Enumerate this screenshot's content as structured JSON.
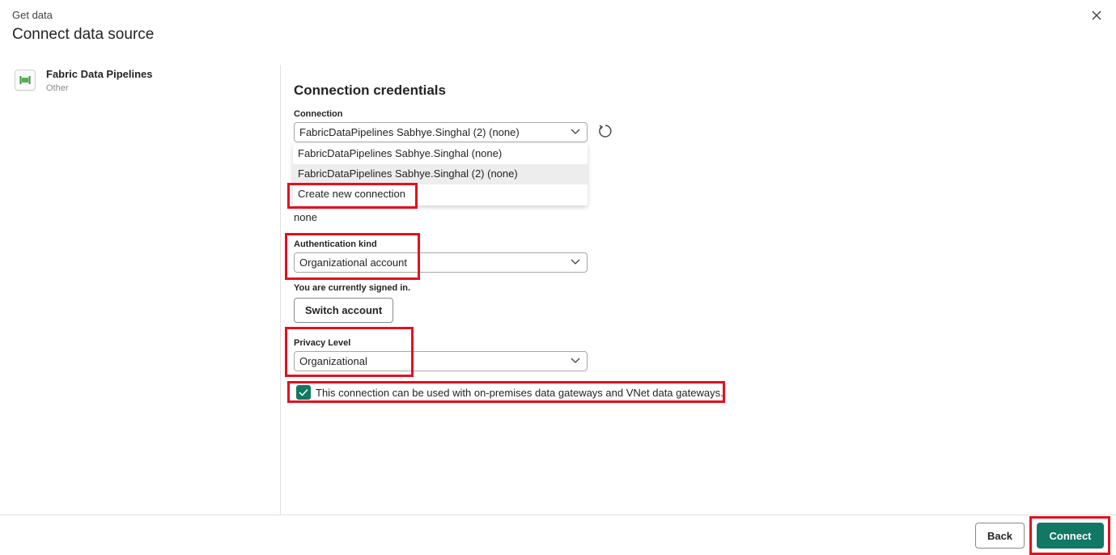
{
  "header": {
    "subtitle": "Get data",
    "title": "Connect data source",
    "close_icon": "close-icon"
  },
  "source": {
    "name": "Fabric Data Pipelines",
    "category": "Other",
    "icon": "pipeline-icon"
  },
  "credentials": {
    "section_title": "Connection credentials",
    "connection": {
      "label": "Connection",
      "value": "FabricDataPipelines Sabhye.Singhal (2) (none)",
      "options": [
        "FabricDataPipelines Sabhye.Singhal (none)",
        "FabricDataPipelines Sabhye.Singhal (2) (none)",
        "Create new connection"
      ],
      "refresh_icon": "refresh-icon"
    },
    "none_value": "none",
    "auth": {
      "label": "Authentication kind",
      "value": "Organizational account"
    },
    "signed_in_text": "You are currently signed in.",
    "switch_account_label": "Switch account",
    "privacy": {
      "label": "Privacy Level",
      "value": "Organizational"
    },
    "gateway_checkbox": {
      "checked": true,
      "label": "This connection can be used with on-premises data gateways and VNet data gateways."
    }
  },
  "footer": {
    "back_label": "Back",
    "connect_label": "Connect"
  },
  "colors": {
    "primary": "#117865",
    "highlight": "#e3101e"
  }
}
